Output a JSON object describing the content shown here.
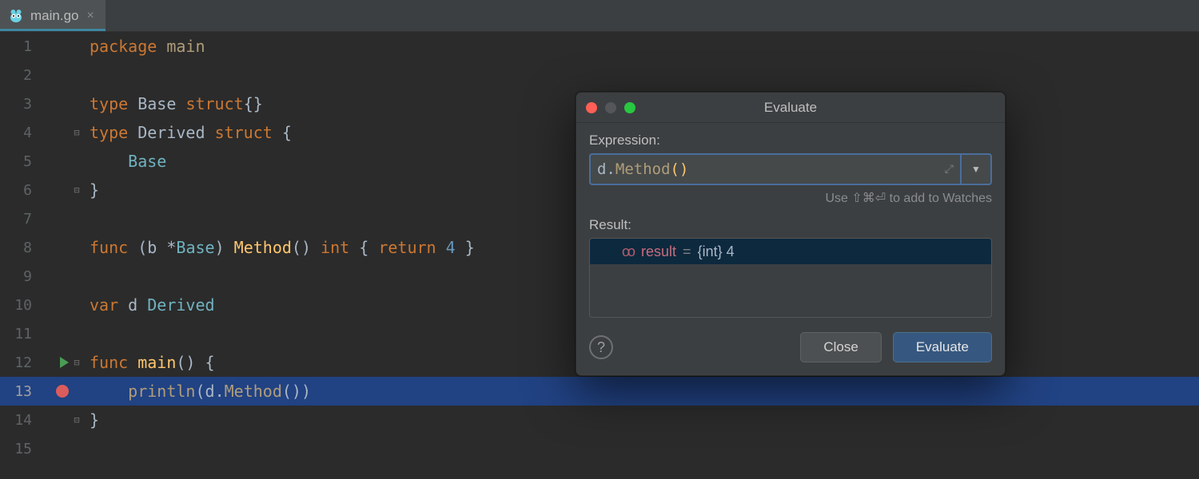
{
  "tab": {
    "filename": "main.go",
    "close_glyph": "×"
  },
  "editor": {
    "lines": [
      "1",
      "2",
      "3",
      "4",
      "5",
      "6",
      "7",
      "8",
      "9",
      "10",
      "11",
      "12",
      "13",
      "14",
      "15"
    ],
    "code": {
      "l1_kw1": "package",
      "l1_id": "main",
      "l3_kw1": "type",
      "l3_id": "Base",
      "l3_kw2": "struct",
      "l4_kw1": "type",
      "l4_id": "Derived",
      "l4_kw2": "struct",
      "l5_id": "Base",
      "l8_kw1": "func",
      "l8_id1": "b",
      "l8_type": "Base",
      "l8_fn": "Method",
      "l8_ret": "int",
      "l8_kw2": "return",
      "l8_num": "4",
      "l10_kw": "var",
      "l10_id": "d",
      "l10_type": "Derived",
      "l12_kw": "func",
      "l12_fn": "main",
      "l13_fn": "println",
      "l13_id": "d",
      "l13_call": "Method"
    }
  },
  "dialog": {
    "title": "Evaluate",
    "expression_label": "Expression:",
    "expression_prefix": "d.",
    "expression_fn": "Method",
    "hint": "Use ⇧⌘⏎ to add to Watches",
    "result_label": "Result:",
    "result_name": "result",
    "result_eq": " = ",
    "result_value": "{int} 4",
    "close_label": "Close",
    "evaluate_label": "Evaluate",
    "help_glyph": "?",
    "dropdown_glyph": "▼",
    "expand_glyph": "⤢"
  }
}
